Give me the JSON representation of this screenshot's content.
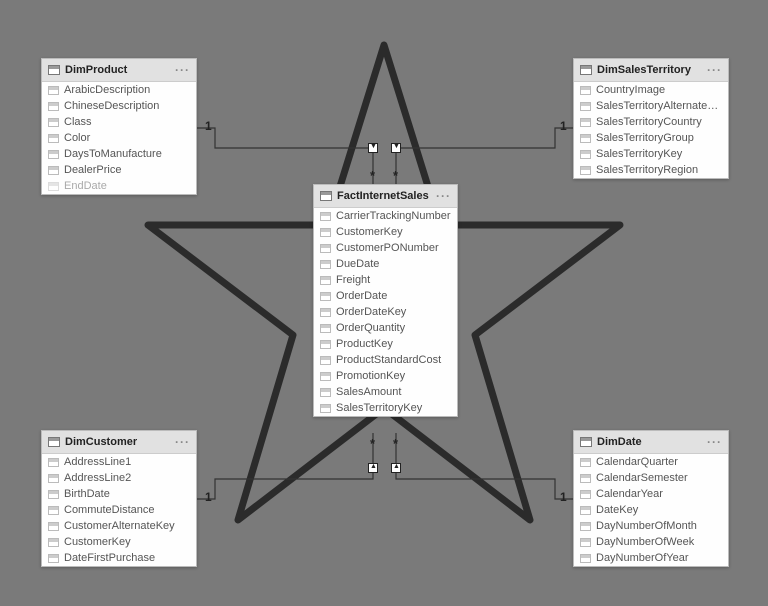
{
  "tables": {
    "dimProduct": {
      "title": "DimProduct",
      "fields": [
        "ArabicDescription",
        "ChineseDescription",
        "Class",
        "Color",
        "DaysToManufacture",
        "DealerPrice",
        "EndDate"
      ]
    },
    "dimSalesTerritory": {
      "title": "DimSalesTerritory",
      "fields": [
        "CountryImage",
        "SalesTerritoryAlternateKey",
        "SalesTerritoryCountry",
        "SalesTerritoryGroup",
        "SalesTerritoryKey",
        "SalesTerritoryRegion"
      ]
    },
    "factInternetSales": {
      "title": "FactInternetSales",
      "fields": [
        "CarrierTrackingNumber",
        "CustomerKey",
        "CustomerPONumber",
        "DueDate",
        "Freight",
        "OrderDate",
        "OrderDateKey",
        "OrderQuantity",
        "ProductKey",
        "ProductStandardCost",
        "PromotionKey",
        "SalesAmount",
        "SalesTerritoryKey"
      ]
    },
    "dimCustomer": {
      "title": "DimCustomer",
      "fields": [
        "AddressLine1",
        "AddressLine2",
        "BirthDate",
        "CommuteDistance",
        "CustomerAlternateKey",
        "CustomerKey",
        "DateFirstPurchase"
      ]
    },
    "dimDate": {
      "title": "DimDate",
      "fields": [
        "CalendarQuarter",
        "CalendarSemester",
        "CalendarYear",
        "DateKey",
        "DayNumberOfMonth",
        "DayNumberOfWeek",
        "DayNumberOfYear"
      ]
    }
  },
  "relationships": {
    "oneLabel": "1",
    "manyLabel": "*"
  },
  "moreGlyph": "···"
}
